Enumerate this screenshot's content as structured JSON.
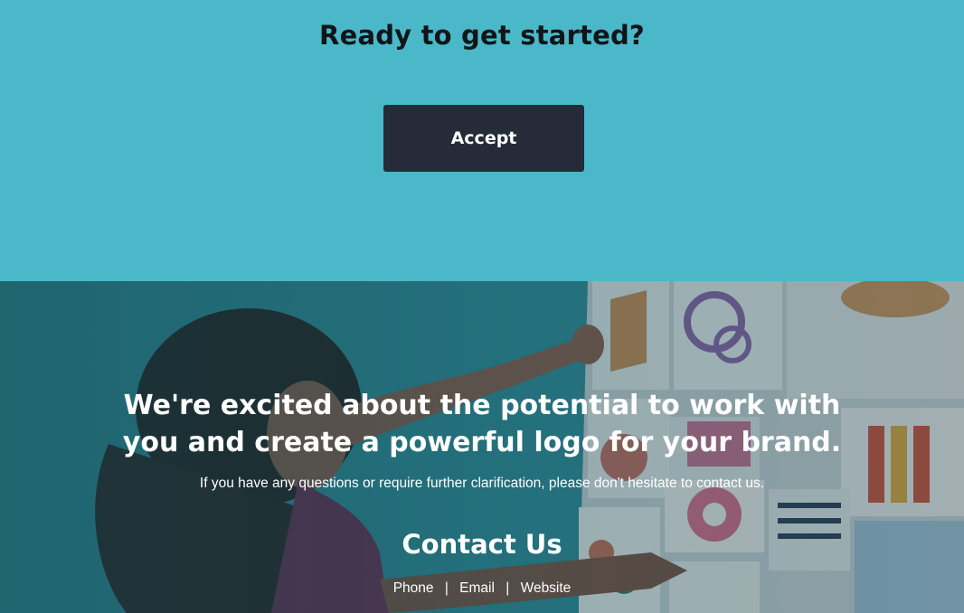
{
  "cta": {
    "title": "Ready to get started?",
    "button_label": "Accept"
  },
  "hero": {
    "heading_line1": "We're excited about the potential to work with",
    "heading_line2": "you and create a powerful logo for your brand.",
    "subtext": "If you have any questions or require further clarification, please don't hesitate to contact us.",
    "contact_title": "Contact Us",
    "links": {
      "phone": "Phone",
      "email": "Email",
      "website": "Website",
      "separator": "|"
    }
  },
  "colors": {
    "cta_background": "#4ab8c8",
    "button_background": "#262b3a",
    "title_text": "#111418",
    "hero_text": "#ffffff"
  },
  "image": {
    "description_icon": "photo-woman-arranging-design-cards"
  }
}
